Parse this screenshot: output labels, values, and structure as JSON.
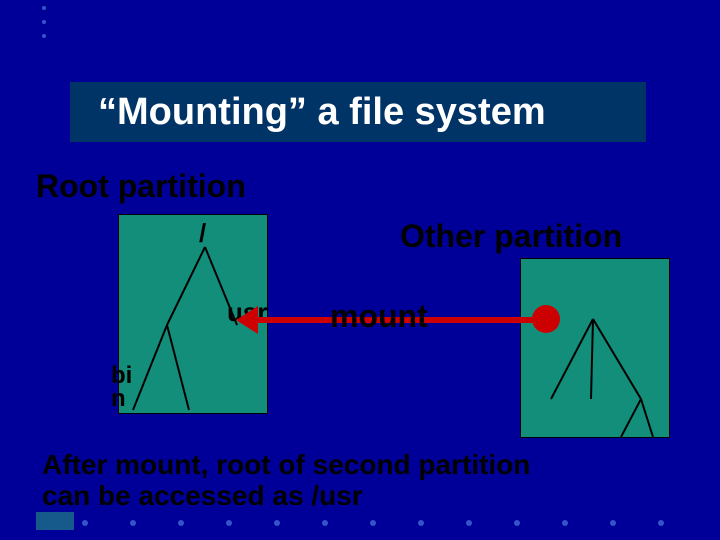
{
  "title": "“Mounting” a file system",
  "labels": {
    "root_partition": "Root partition",
    "other_partition": "Other partition",
    "mount": "mount"
  },
  "tree_left": {
    "root": "/",
    "children": {
      "bin": "bi\nn",
      "usr": "usr"
    }
  },
  "footer": "After mount, root of second partition\ncan be accessed as /usr",
  "colors": {
    "background": "#000099",
    "banner": "#003366",
    "tree_fill": "#138e7b",
    "arrow": "#cc0000",
    "dots": "#3355cc"
  }
}
